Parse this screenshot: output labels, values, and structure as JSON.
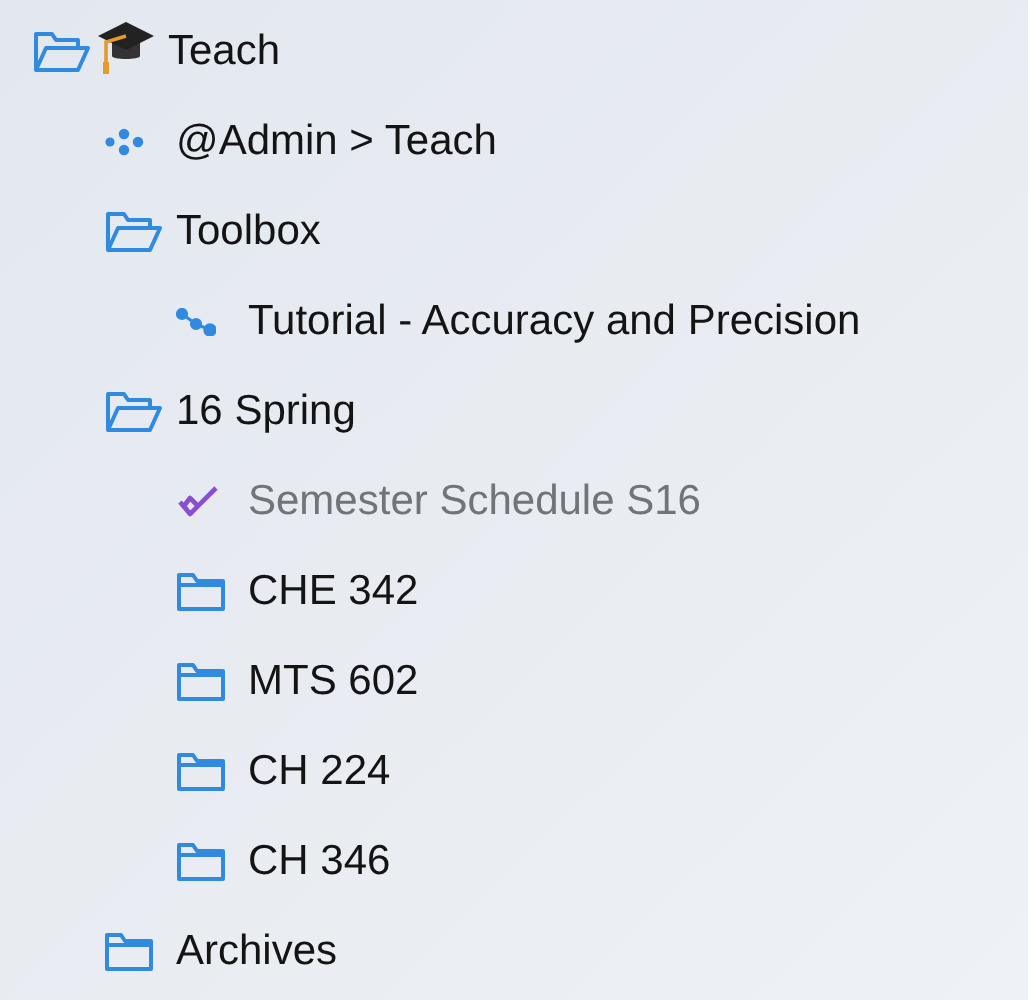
{
  "root": {
    "label": "Teach",
    "kind": "folder",
    "expanded": true,
    "completed": false,
    "children": [
      {
        "label": "@Admin > Teach",
        "kind": "project",
        "expanded": false,
        "completed": false
      },
      {
        "label": "Toolbox",
        "kind": "folder",
        "expanded": true,
        "completed": false,
        "children": [
          {
            "label": "Tutorial - Accuracy and Precision",
            "kind": "sequence",
            "expanded": false,
            "completed": false
          }
        ]
      },
      {
        "label": "16 Spring",
        "kind": "folder",
        "expanded": true,
        "completed": false,
        "children": [
          {
            "label": "Semester Schedule S16",
            "kind": "checklist",
            "expanded": false,
            "completed": true
          },
          {
            "label": "CHE 342",
            "kind": "folder",
            "expanded": false,
            "completed": false
          },
          {
            "label": "MTS 602",
            "kind": "folder",
            "expanded": false,
            "completed": false
          },
          {
            "label": "CH 224",
            "kind": "folder",
            "expanded": false,
            "completed": false
          },
          {
            "label": "CH 346",
            "kind": "folder",
            "expanded": false,
            "completed": false
          }
        ]
      },
      {
        "label": "Archives",
        "kind": "folder",
        "expanded": false,
        "completed": false
      }
    ]
  }
}
